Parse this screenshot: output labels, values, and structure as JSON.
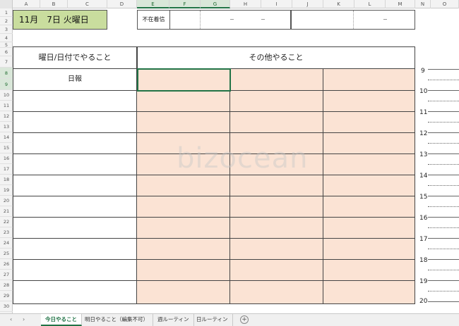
{
  "columns": [
    "A",
    "B",
    "C",
    "D",
    "E",
    "F",
    "G",
    "H",
    "I",
    "J",
    "K",
    "L",
    "M",
    "N",
    "O"
  ],
  "selected_columns": [
    "E",
    "F",
    "G"
  ],
  "rows": [
    "1",
    "2",
    "3",
    "4",
    "5",
    "6",
    "7",
    "8",
    "9",
    "10",
    "11",
    "12",
    "13",
    "14",
    "15",
    "16",
    "17",
    "18",
    "19",
    "20",
    "21",
    "22",
    "23",
    "24",
    "25",
    "26",
    "27",
    "28",
    "29",
    "30"
  ],
  "selected_rows": [
    "8",
    "9"
  ],
  "header": {
    "date": "11月　7日  火曜日",
    "absence_label": "不在着信",
    "absence_dash_1": "−",
    "absence_dash_2": "−",
    "absence_dash_3": "−"
  },
  "table": {
    "left_header": "曜日/日付でやること",
    "right_header": "その他やること",
    "first_item": "日報"
  },
  "times": [
    "9",
    "10",
    "11",
    "12",
    "13",
    "14",
    "15",
    "16",
    "17",
    "18",
    "19",
    "20"
  ],
  "watermark": "bizocean",
  "tabs": {
    "nav_prev": "‹",
    "nav_next": "›",
    "items": [
      "今日やること",
      "明日やること（編集不可）",
      "週ルーティン",
      "日ルーティン"
    ],
    "add": "+"
  },
  "colors": {
    "date_fill": "#c9dd9e",
    "task_fill": "#fbe3d4",
    "accent": "#217346"
  }
}
